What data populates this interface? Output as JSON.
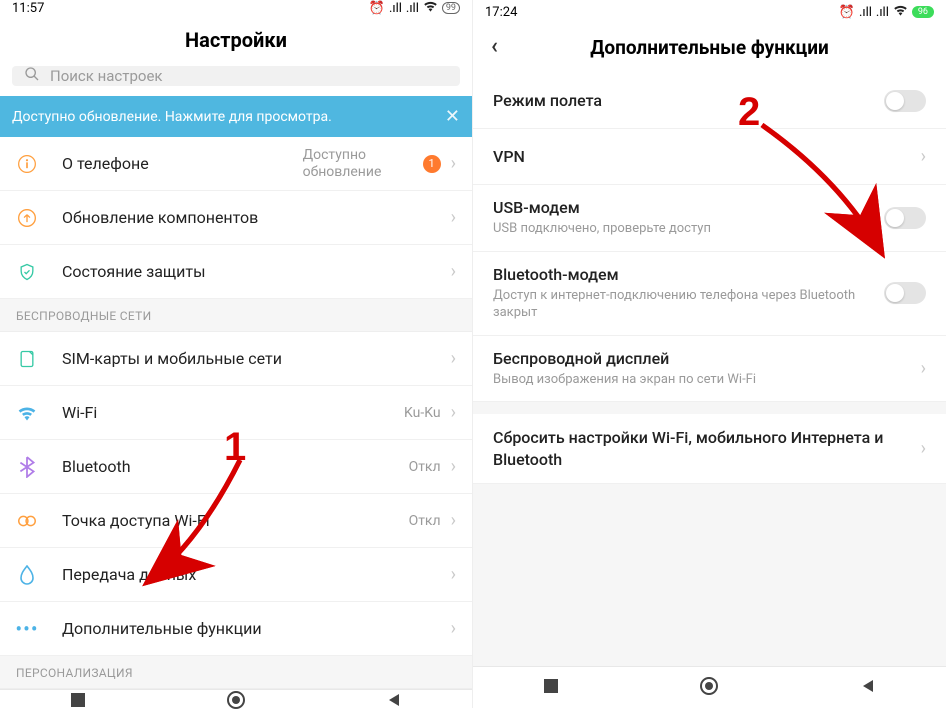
{
  "left": {
    "status_time": "11:57",
    "battery": "99",
    "title": "Настройки",
    "search_placeholder": "Поиск настроек",
    "banner": "Доступно обновление. Нажмите для просмотра.",
    "about_phone": "О телефоне",
    "about_phone_rt": "Доступно обновление",
    "badge": "1",
    "updates": "Обновление компонентов",
    "security": "Состояние защиты",
    "section_wireless": "БЕСПРОВОДНЫЕ СЕТИ",
    "sim": "SIM-карты и мобильные сети",
    "wifi": "Wi-Fi",
    "wifi_val": "Ku-Ku",
    "bluetooth": "Bluetooth",
    "bluetooth_val": "Откл",
    "hotspot": "Точка доступа Wi-Fi",
    "hotspot_val": "Откл",
    "data": "Передача данных",
    "more": "Дополнительные функции",
    "section_personal": "ПЕРСОНАЛИЗАЦИЯ"
  },
  "right": {
    "status_time": "17:24",
    "battery": "96",
    "title": "Дополнительные функции",
    "airplane": "Режим полета",
    "vpn": "VPN",
    "usb_t": "USB-модем",
    "usb_s": "USB подключено, проверьте доступ",
    "bt_t": "Bluetooth-модем",
    "bt_s": "Доступ к интернет-подключению телефона через Bluetooth закрыт",
    "wd_t": "Беспроводной дисплей",
    "wd_s": "Вывод изображения на экран по сети Wi-Fi",
    "reset": "Сбросить настройки Wi-Fi, мобильного Интернета и Bluetooth"
  },
  "annotations": {
    "one": "1",
    "two": "2"
  }
}
